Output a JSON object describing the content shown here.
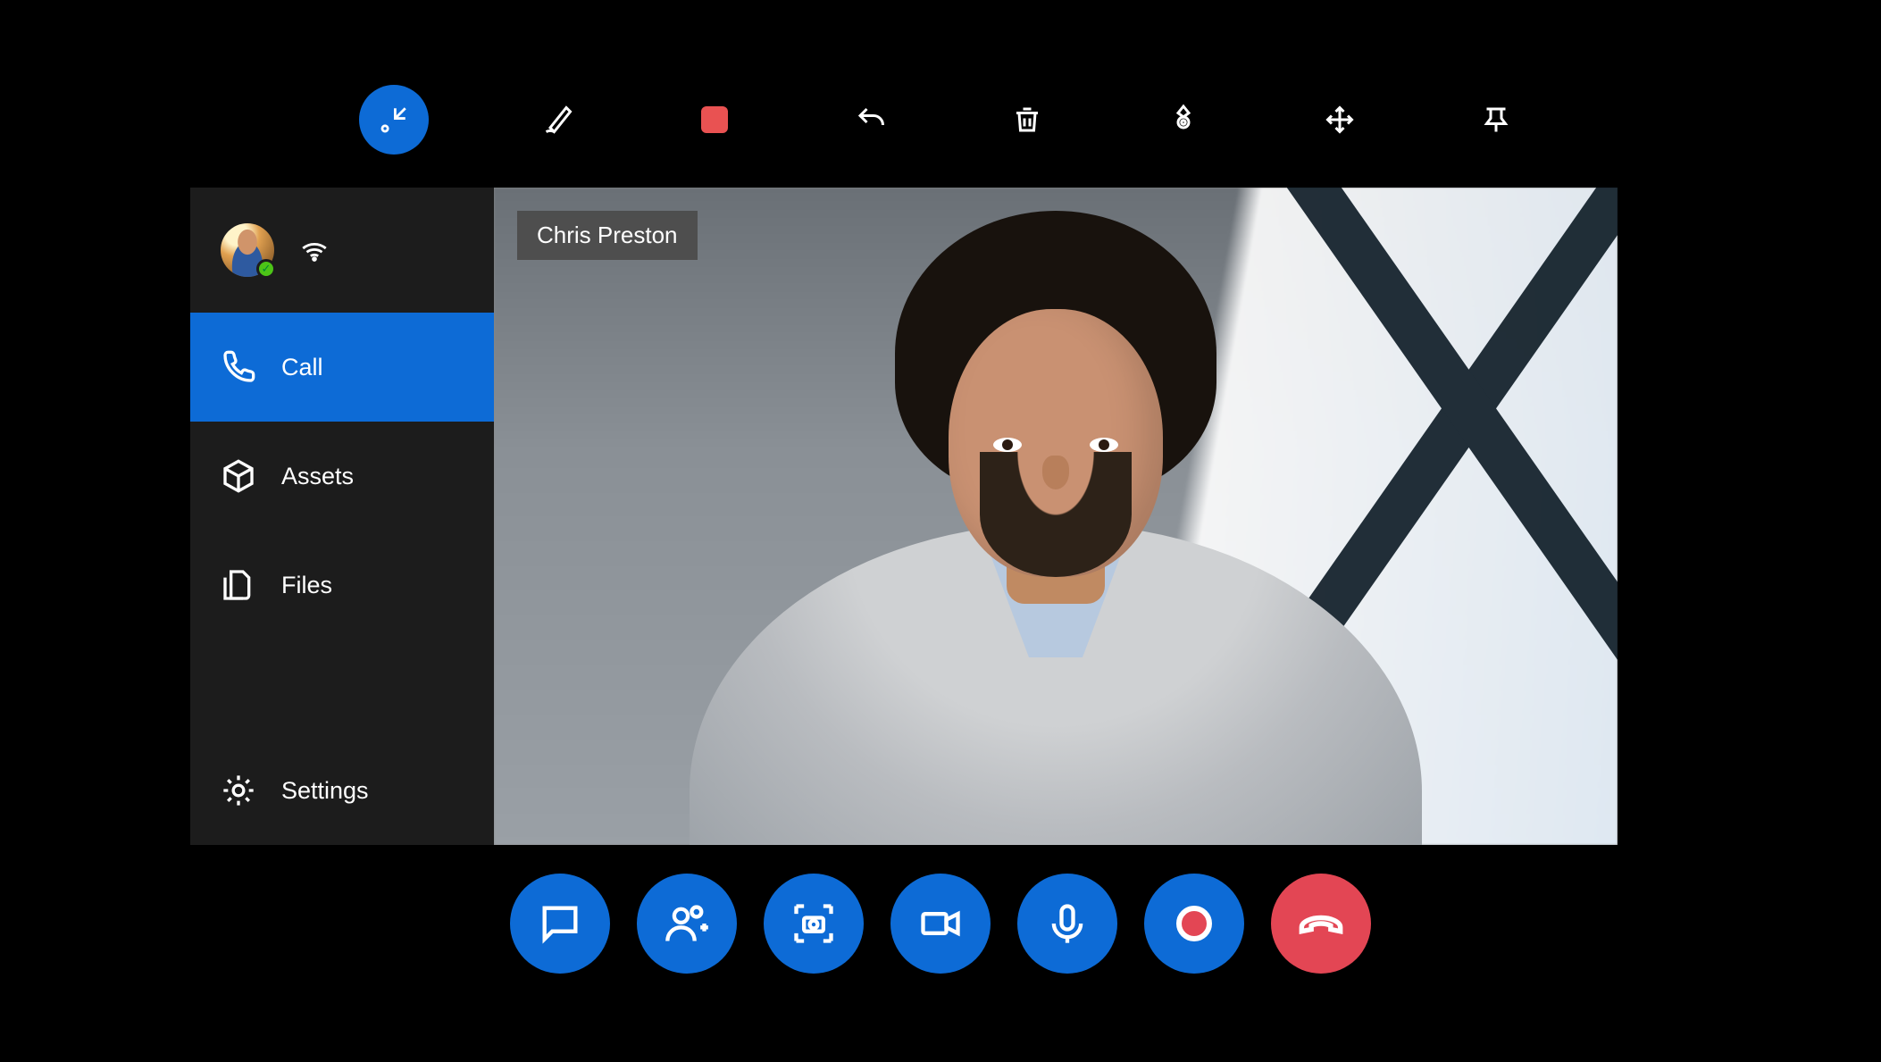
{
  "colors": {
    "accent": "#0d6bd6",
    "danger": "#e34654",
    "record": "#e95252"
  },
  "toolbar_top": {
    "minimize": "minimize",
    "ink": "ink",
    "record_stop": "stop-record",
    "undo": "undo",
    "delete": "delete",
    "annotate": "annotate",
    "move": "move",
    "pin": "pin"
  },
  "sidebar": {
    "user": {
      "name": "User",
      "status": "available"
    },
    "items": [
      {
        "icon": "phone",
        "label": "Call",
        "active": true
      },
      {
        "icon": "assets",
        "label": "Assets",
        "active": false
      },
      {
        "icon": "files",
        "label": "Files",
        "active": false
      },
      {
        "icon": "settings",
        "label": "Settings",
        "active": false
      }
    ]
  },
  "video": {
    "participant_name": "Chris Preston"
  },
  "toolbar_bottom": {
    "chat": "chat",
    "add_participant": "add-participant",
    "snapshot": "snapshot",
    "video": "video",
    "mic": "microphone",
    "record": "record",
    "end_call": "end-call"
  }
}
